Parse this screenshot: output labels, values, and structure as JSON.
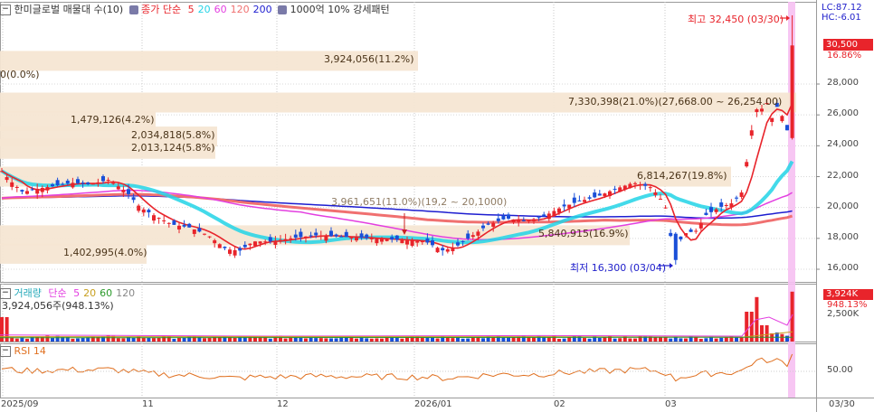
{
  "legend": {
    "title": "한미글로벌 매물대 수(10)",
    "ma_prefix": "종가 단순",
    "ma_periods": [
      "5",
      "20",
      "60",
      "120",
      "200"
    ],
    "ma_colors": [
      "#e8242b",
      "#22d3e6",
      "#e33fe0",
      "#f07070",
      "#1d1dd0"
    ],
    "extra": "1000억 10% 강세패턴"
  },
  "price_axis": {
    "ticks": [
      "28,000",
      "26,000",
      "24,000",
      "22,000",
      "20,000",
      "18,000",
      "16,000"
    ],
    "lc": "LC:87.12",
    "hc": "HC:-6.01",
    "current_price": "30,500",
    "current_pct": "16.86%"
  },
  "annotations": {
    "high": "최고 32,450 (03/30)",
    "low": "최저 16,300 (03/04)",
    "mid_label": "3,961,651(11.0%)(19,2 ~ 20,1000)"
  },
  "volume_profile": [
    {
      "label": "3,924,056(11.2%)",
      "price": 29500
    },
    {
      "label": "0(0.0%)",
      "price": 28500
    },
    {
      "label": "7,330,398(21.0%)(27,668.00 ~ 26,254.00)",
      "price": 26800
    },
    {
      "label": "1,479,126(4.2%)",
      "price": 25600
    },
    {
      "label": "2,034,818(5.8%)",
      "price": 24600
    },
    {
      "label": "2,013,124(5.8%)",
      "price": 23800
    },
    {
      "label": "6,814,267(19.8%)",
      "price": 22000
    },
    {
      "label": "5,840,915(16.9%)",
      "price": 18200
    },
    {
      "label": "1,402,995(4.0%)",
      "price": 17000
    }
  ],
  "volume_panel": {
    "legend_label": "거래량",
    "ma_prefix": "단순",
    "ma_periods": [
      "5",
      "20",
      "60",
      "120"
    ],
    "ma_colors": [
      "#e33fe0",
      "#c8a020",
      "#2a9a2a",
      "#888888"
    ],
    "last_value": "3,924,056주(948.13%)",
    "axis_value": "3,924K",
    "axis_pct": "948.13%",
    "axis_tick": "2,500K"
  },
  "rsi_panel": {
    "label": "RSI 14",
    "tick": "50.00"
  },
  "x_axis": {
    "labels": [
      "2025/09",
      "11",
      "12",
      "2026/01",
      "02",
      "03",
      "03/30"
    ]
  },
  "chart_data": {
    "type": "candlestick",
    "title": "한미글로벌 매물대 수(10)",
    "ylim": [
      15000,
      33200
    ],
    "x_range": [
      "2025/09",
      "2026/03/30"
    ],
    "candles_approx": [
      {
        "period": "2025/09 start",
        "close": 21500
      },
      {
        "period": "2025/10",
        "close": 21500
      },
      {
        "period": "2025/11 early",
        "close": 19500
      },
      {
        "period": "2025/11 late",
        "close": 17500
      },
      {
        "period": "2025/12",
        "close": 18000
      },
      {
        "period": "2026/01 late",
        "close": 17200
      },
      {
        "period": "2026/02 early",
        "close": 19500
      },
      {
        "period": "2026/02 late",
        "close": 21500
      },
      {
        "period": "2026/03/04",
        "low": 16300
      },
      {
        "period": "2026/03 mid",
        "close": 20500
      },
      {
        "period": "2026/03 late",
        "close": 26500
      },
      {
        "period": "2026/03/30",
        "high": 32450,
        "close": 30500
      }
    ]
  }
}
